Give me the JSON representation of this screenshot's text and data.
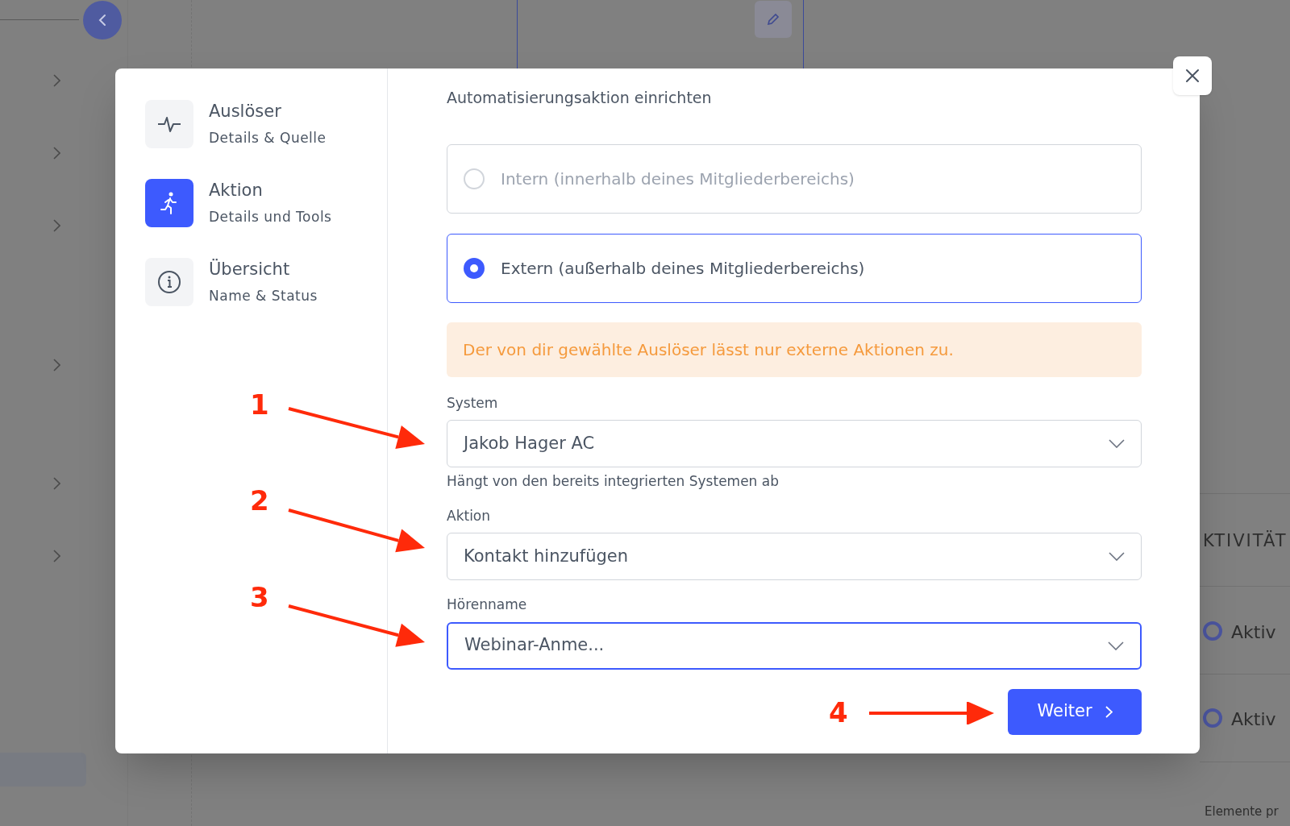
{
  "background": {
    "column_header": "KTIVITÄT",
    "rows": [
      {
        "status": "Aktiv",
        "selected": false
      },
      {
        "status": "Aktiv",
        "selected": false
      }
    ],
    "footer_text": "Elemente pr"
  },
  "dialog": {
    "subtitle": "Automatisierungsaktion einrichten",
    "steps": [
      {
        "kind": "trigger",
        "title": "Auslöser",
        "subtitle": "Details & Quelle",
        "selected": false
      },
      {
        "kind": "action",
        "title": "Aktion",
        "subtitle": "Details und Tools",
        "selected": true
      },
      {
        "kind": "overview",
        "title": "Übersicht",
        "subtitle": "Name & Status",
        "selected": false
      }
    ],
    "options": [
      {
        "label": "Intern (innerhalb deines Mitgliederbereichs)",
        "selected": false,
        "disabled": true
      },
      {
        "label": "Extern (außerhalb deines Mitgliederbereichs)",
        "selected": true,
        "disabled": false
      }
    ],
    "alert": "Der von dir gewählte Auslöser lässt nur externe Aktionen zu.",
    "fields": [
      {
        "label": "System",
        "value": "Jakob Hager AC",
        "hint": "Hängt von den bereits integrierten Systemen ab",
        "focused": false
      },
      {
        "label": "Aktion",
        "value": "Kontakt hinzufügen",
        "focused": false
      },
      {
        "label": "Hörenname",
        "value": "Webinar-Anme...",
        "focused": true
      }
    ],
    "next_button": "Weiter"
  },
  "annotations": [
    {
      "number": "1"
    },
    {
      "number": "2"
    },
    {
      "number": "3"
    },
    {
      "number": "4"
    }
  ]
}
